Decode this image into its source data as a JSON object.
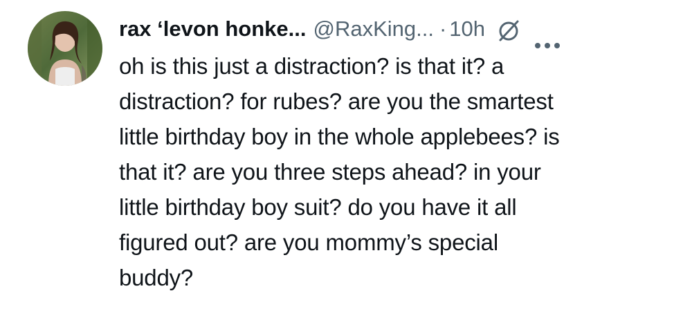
{
  "tweet": {
    "display_name": "rax ‘levon honke...",
    "handle": "@RaxKing...",
    "separator": "·",
    "time": "10h",
    "icons": {
      "badge": "slashed-circle-icon",
      "more": "more-options-icon",
      "avatar": "profile-photo"
    },
    "text": "oh is this just a distraction? is that it? a\ndistraction? for rubes? are you the smartest\nlittle birthday boy in the whole applebees? is\nthat it? are you three steps ahead? in your\nlittle birthday boy suit? do you have it all\nfigured out? are you mommy’s special\nbuddy?"
  }
}
